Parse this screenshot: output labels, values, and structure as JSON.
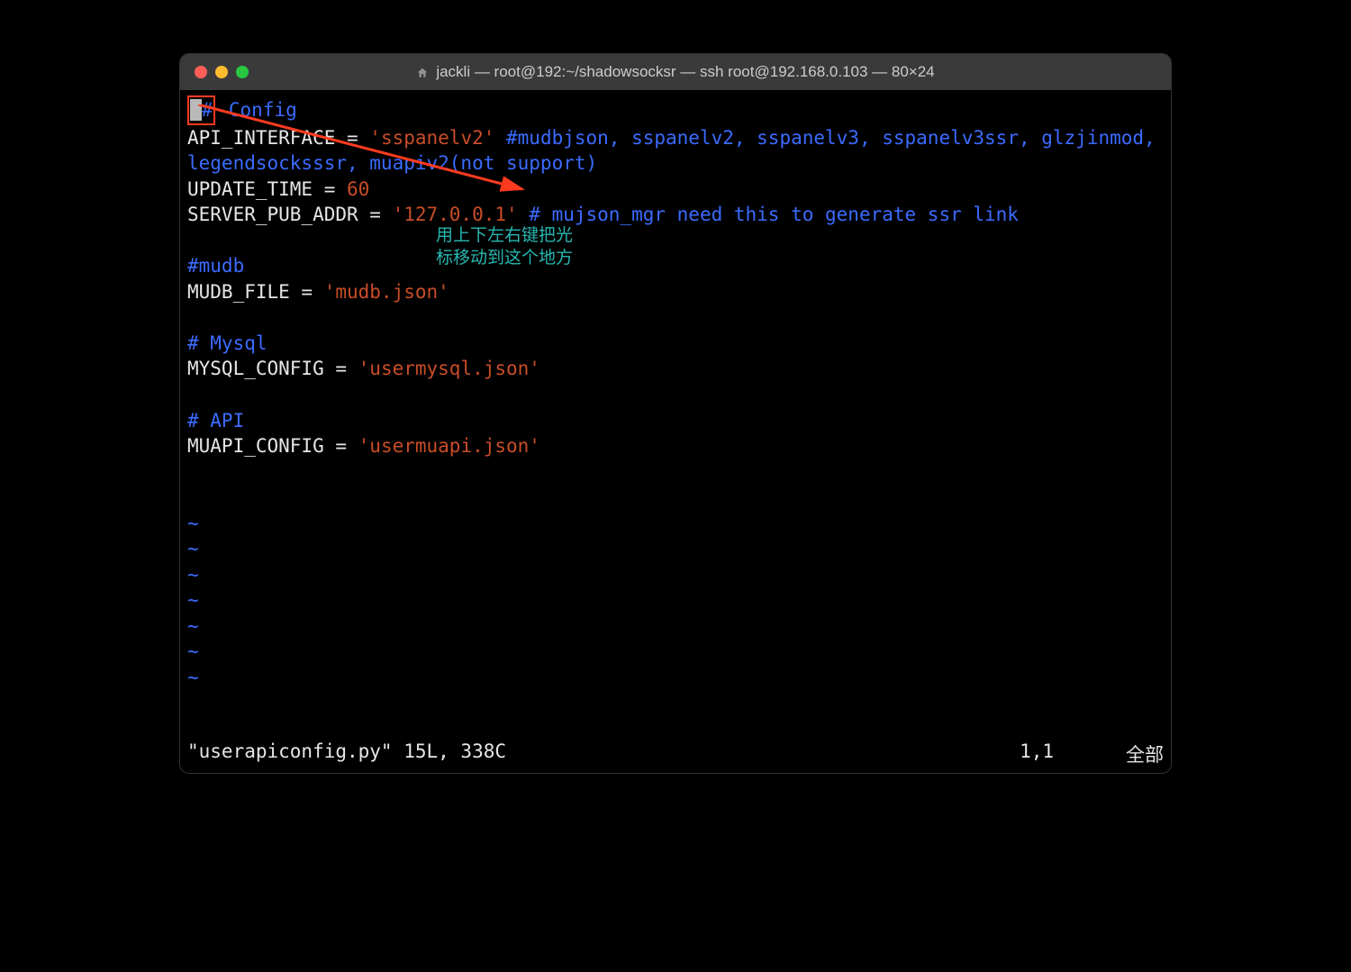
{
  "window": {
    "title": "jackli — root@192:~/shadowsocksr — ssh root@192.168.0.103 — 80×24"
  },
  "code": {
    "hash": "#",
    "config_label": " Config",
    "api_iface_key": "API_INTERFACE = ",
    "api_iface_val": "'sspanelv2'",
    "api_iface_comment": " #mudbjson, sspanelv2, sspanelv3, sspanelv3ssr, glzjinmod, legendsocksssr, muapiv2(not support)",
    "update_key": "UPDATE_TIME = ",
    "update_val": "60",
    "server_key": "SERVER_PUB_ADDR = ",
    "server_val": "'127.0.0.1'",
    "server_comment": " # mujson_mgr need this to generate ssr link",
    "mudb_comment": "#mudb",
    "mudb_key": "MUDB_FILE = ",
    "mudb_val": "'mudb.json'",
    "mysql_comment": "# Mysql",
    "mysql_key": "MYSQL_CONFIG = ",
    "mysql_val": "'usermysql.json'",
    "api_comment": "# API",
    "muapi_key": "MUAPI_CONFIG = ",
    "muapi_val": "'usermuapi.json'",
    "tilde": "~"
  },
  "status": {
    "file": "\"userapiconfig.py\" 15L, 338C",
    "pos": "1,1",
    "scroll": "全部"
  },
  "annotation": {
    "line1": "用上下左右键把光",
    "line2": "标移动到这个地方"
  }
}
